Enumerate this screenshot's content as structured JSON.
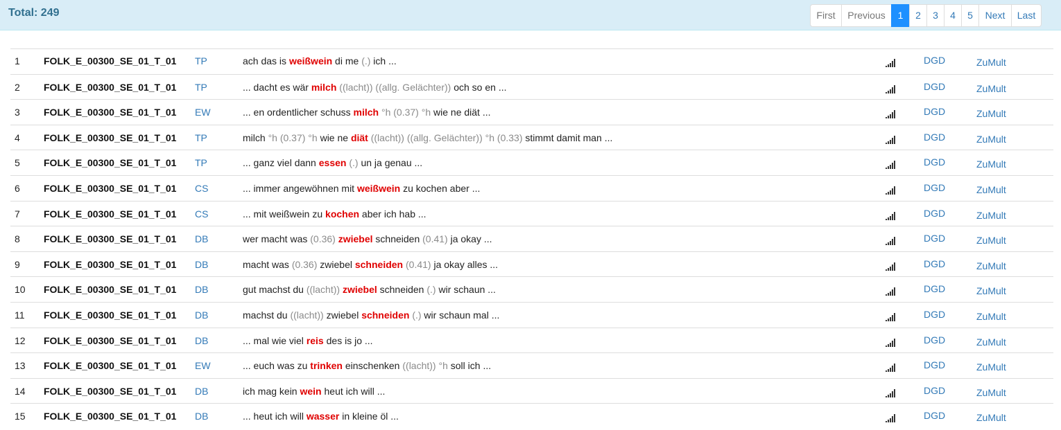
{
  "header": {
    "total_label": "Total: 249"
  },
  "pagination": {
    "first": "First",
    "previous": "Previous",
    "pages": [
      "1",
      "2",
      "3",
      "4",
      "5"
    ],
    "active_page": "1",
    "next": "Next",
    "last": "Last"
  },
  "links": {
    "dgd": "DGD",
    "zumult": "ZuMult"
  },
  "icons": {
    "signal": "signal-bars-icon"
  },
  "colors": {
    "header_bg": "#d9edf7",
    "total_text": "#31708f",
    "link": "#337ab7",
    "active_page": "#1e90ff",
    "keyword": "#e00000",
    "pause": "#8a8a8a"
  },
  "rows": [
    {
      "num": "1",
      "id": "FOLK_E_00300_SE_01_T_01",
      "speaker": "TP",
      "kwic": [
        {
          "t": "ach das is ",
          "k": "n"
        },
        {
          "t": "weißwein",
          "k": "h"
        },
        {
          "t": " di me ",
          "k": "n"
        },
        {
          "t": "(.)",
          "k": "p"
        },
        {
          "t": " ich ...",
          "k": "n"
        }
      ]
    },
    {
      "num": "2",
      "id": "FOLK_E_00300_SE_01_T_01",
      "speaker": "TP",
      "kwic": [
        {
          "t": "... dacht es wär ",
          "k": "n"
        },
        {
          "t": "milch",
          "k": "h"
        },
        {
          "t": " ",
          "k": "n"
        },
        {
          "t": "((lacht)) ((allg. Gelächter))",
          "k": "p"
        },
        {
          "t": " och so en ...",
          "k": "n"
        }
      ]
    },
    {
      "num": "3",
      "id": "FOLK_E_00300_SE_01_T_01",
      "speaker": "EW",
      "kwic": [
        {
          "t": "... en ordentlicher schuss ",
          "k": "n"
        },
        {
          "t": "milch",
          "k": "h"
        },
        {
          "t": " ",
          "k": "n"
        },
        {
          "t": "°h (0.37) °h",
          "k": "p"
        },
        {
          "t": " wie ne diät ...",
          "k": "n"
        }
      ]
    },
    {
      "num": "4",
      "id": "FOLK_E_00300_SE_01_T_01",
      "speaker": "TP",
      "kwic": [
        {
          "t": "milch ",
          "k": "n"
        },
        {
          "t": "°h (0.37) °h",
          "k": "p"
        },
        {
          "t": " wie ne ",
          "k": "n"
        },
        {
          "t": "diät",
          "k": "h"
        },
        {
          "t": " ",
          "k": "n"
        },
        {
          "t": "((lacht)) ((allg. Gelächter)) °h (0.33)",
          "k": "p"
        },
        {
          "t": " stimmt damit man ...",
          "k": "n"
        }
      ]
    },
    {
      "num": "5",
      "id": "FOLK_E_00300_SE_01_T_01",
      "speaker": "TP",
      "kwic": [
        {
          "t": "... ganz viel dann ",
          "k": "n"
        },
        {
          "t": "essen",
          "k": "h"
        },
        {
          "t": " ",
          "k": "n"
        },
        {
          "t": "(.)",
          "k": "p"
        },
        {
          "t": " un ja genau ...",
          "k": "n"
        }
      ]
    },
    {
      "num": "6",
      "id": "FOLK_E_00300_SE_01_T_01",
      "speaker": "CS",
      "kwic": [
        {
          "t": "... immer angewöhnen mit ",
          "k": "n"
        },
        {
          "t": "weißwein",
          "k": "h"
        },
        {
          "t": " zu kochen aber ...",
          "k": "n"
        }
      ]
    },
    {
      "num": "7",
      "id": "FOLK_E_00300_SE_01_T_01",
      "speaker": "CS",
      "kwic": [
        {
          "t": "... mit weißwein zu ",
          "k": "n"
        },
        {
          "t": "kochen",
          "k": "h"
        },
        {
          "t": " aber ich hab ...",
          "k": "n"
        }
      ]
    },
    {
      "num": "8",
      "id": "FOLK_E_00300_SE_01_T_01",
      "speaker": "DB",
      "kwic": [
        {
          "t": "wer macht was ",
          "k": "n"
        },
        {
          "t": "(0.36)",
          "k": "p"
        },
        {
          "t": " ",
          "k": "n"
        },
        {
          "t": "zwiebel",
          "k": "h"
        },
        {
          "t": " schneiden ",
          "k": "n"
        },
        {
          "t": "(0.41)",
          "k": "p"
        },
        {
          "t": " ja okay ...",
          "k": "n"
        }
      ]
    },
    {
      "num": "9",
      "id": "FOLK_E_00300_SE_01_T_01",
      "speaker": "DB",
      "kwic": [
        {
          "t": "macht was ",
          "k": "n"
        },
        {
          "t": "(0.36)",
          "k": "p"
        },
        {
          "t": " zwiebel ",
          "k": "n"
        },
        {
          "t": "schneiden",
          "k": "h"
        },
        {
          "t": " ",
          "k": "n"
        },
        {
          "t": "(0.41)",
          "k": "p"
        },
        {
          "t": " ja okay alles ...",
          "k": "n"
        }
      ]
    },
    {
      "num": "10",
      "id": "FOLK_E_00300_SE_01_T_01",
      "speaker": "DB",
      "kwic": [
        {
          "t": "gut machst du ",
          "k": "n"
        },
        {
          "t": "((lacht))",
          "k": "p"
        },
        {
          "t": " ",
          "k": "n"
        },
        {
          "t": "zwiebel",
          "k": "h"
        },
        {
          "t": " schneiden ",
          "k": "n"
        },
        {
          "t": "(.)",
          "k": "p"
        },
        {
          "t": " wir schaun ...",
          "k": "n"
        }
      ]
    },
    {
      "num": "11",
      "id": "FOLK_E_00300_SE_01_T_01",
      "speaker": "DB",
      "kwic": [
        {
          "t": "machst du ",
          "k": "n"
        },
        {
          "t": "((lacht))",
          "k": "p"
        },
        {
          "t": " zwiebel ",
          "k": "n"
        },
        {
          "t": "schneiden",
          "k": "h"
        },
        {
          "t": " ",
          "k": "n"
        },
        {
          "t": "(.)",
          "k": "p"
        },
        {
          "t": " wir schaun mal ...",
          "k": "n"
        }
      ]
    },
    {
      "num": "12",
      "id": "FOLK_E_00300_SE_01_T_01",
      "speaker": "DB",
      "kwic": [
        {
          "t": "... mal wie viel ",
          "k": "n"
        },
        {
          "t": "reis",
          "k": "h"
        },
        {
          "t": " des is jo ...",
          "k": "n"
        }
      ]
    },
    {
      "num": "13",
      "id": "FOLK_E_00300_SE_01_T_01",
      "speaker": "EW",
      "kwic": [
        {
          "t": "... euch was zu ",
          "k": "n"
        },
        {
          "t": "trinken",
          "k": "h"
        },
        {
          "t": " einschenken ",
          "k": "n"
        },
        {
          "t": "((lacht)) °h",
          "k": "p"
        },
        {
          "t": " soll ich ...",
          "k": "n"
        }
      ]
    },
    {
      "num": "14",
      "id": "FOLK_E_00300_SE_01_T_01",
      "speaker": "DB",
      "kwic": [
        {
          "t": "ich mag kein ",
          "k": "n"
        },
        {
          "t": "wein",
          "k": "h"
        },
        {
          "t": " heut ich will ...",
          "k": "n"
        }
      ]
    },
    {
      "num": "15",
      "id": "FOLK_E_00300_SE_01_T_01",
      "speaker": "DB",
      "kwic": [
        {
          "t": "... heut ich will ",
          "k": "n"
        },
        {
          "t": "wasser",
          "k": "h"
        },
        {
          "t": " in kleine öl ...",
          "k": "n"
        }
      ]
    }
  ]
}
